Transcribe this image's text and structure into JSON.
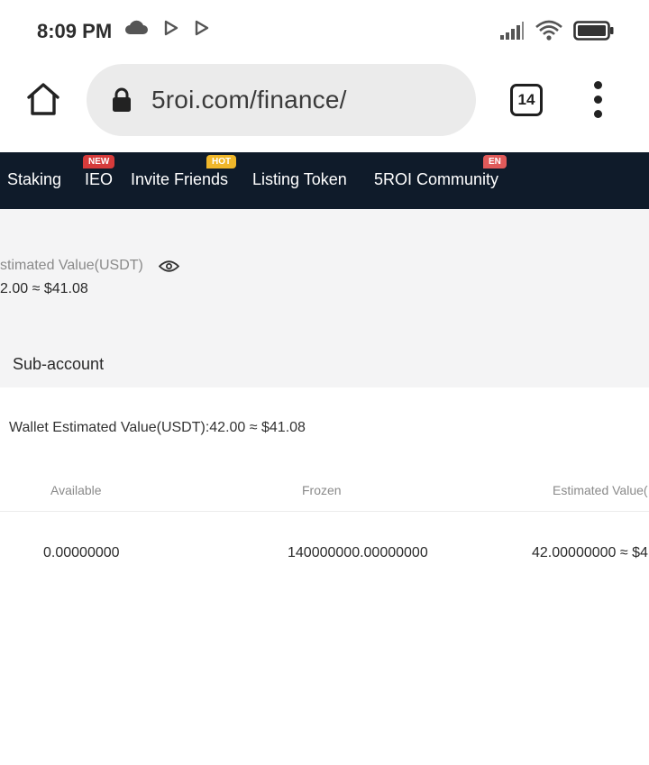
{
  "status_bar": {
    "time": "8:09 PM",
    "left_icons": [
      "cloud-icon",
      "play-store-icon",
      "play-store-icon"
    ],
    "right_icons": [
      "signal-icon",
      "wifi-icon",
      "battery-icon"
    ]
  },
  "browser": {
    "url": "5roi.com/finance/",
    "tab_count": "14",
    "icons": [
      "home-icon",
      "lock-icon",
      "tabs-icon",
      "more-vert-icon"
    ]
  },
  "nav": {
    "items": [
      {
        "label": "Staking"
      },
      {
        "label": "IEO",
        "badge": "NEW"
      },
      {
        "label": "Invite Friends",
        "badge": "HOT"
      },
      {
        "label": "Listing Token"
      },
      {
        "label": "5ROI Community",
        "badge": "EN"
      }
    ],
    "colors": {
      "background": "#0f1b2a",
      "badge_new": "#d63b3b",
      "badge_hot": "#f0b72a",
      "badge_en": "#e05a5a"
    }
  },
  "summary": {
    "estimated_label": "stimated Value(USDT)",
    "estimated_value": "2.00 ≈ $41.08",
    "sub_account_tab": "Sub-account"
  },
  "wallet": {
    "estimated_line": "Wallet Estimated Value(USDT):42.00 ≈ $41.08",
    "columns": [
      "Available",
      "Frozen",
      "Estimated Value("
    ],
    "rows": [
      [
        "0.00000000",
        "140000000.00000000",
        "42.00000000 ≈ $4"
      ]
    ]
  }
}
